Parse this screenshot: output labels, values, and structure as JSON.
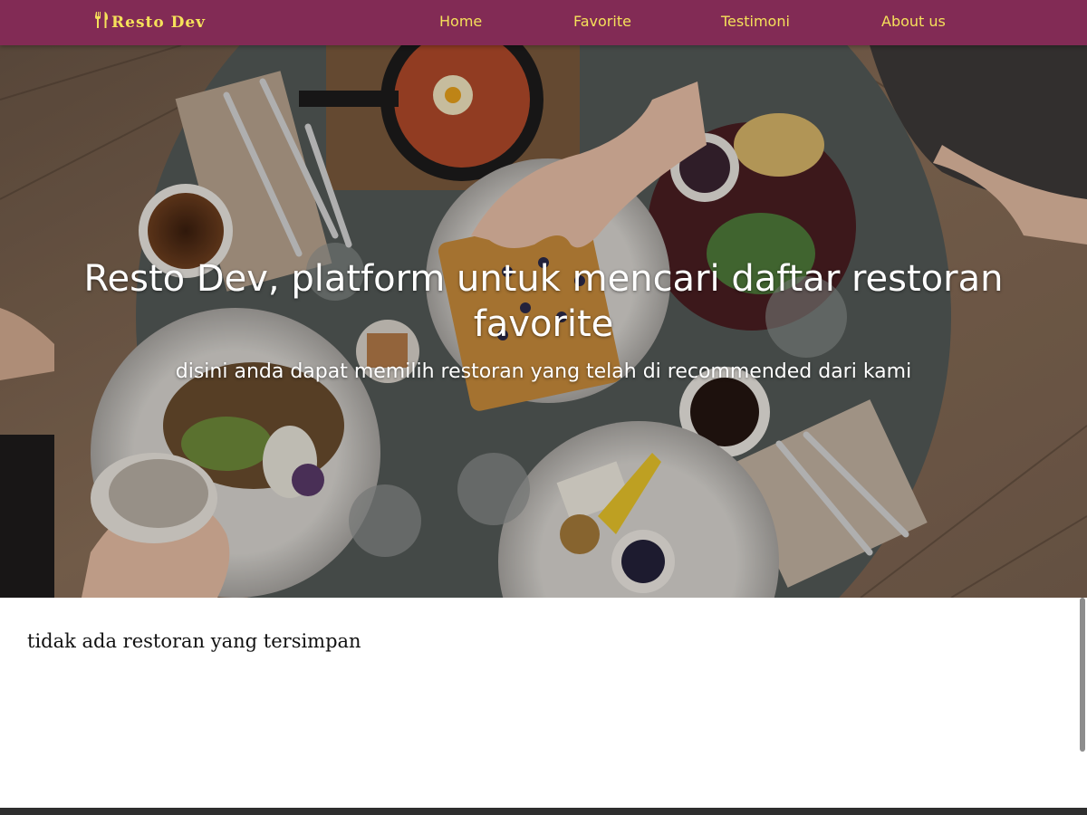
{
  "navbar": {
    "brand": "Resto Dev",
    "brand_icon": "fork-knife-icon",
    "links": [
      "Home",
      "Favorite",
      "Testimoni",
      "About us"
    ],
    "background_color": "#822b55",
    "text_color": "#f5e05a"
  },
  "hero": {
    "title": "Resto Dev, platform untuk mencari daftar restoran favorite",
    "subtitle": "disini anda dapat memilih restoran yang telah di recommended dari kami"
  },
  "content": {
    "empty_message": "tidak ada restoran yang tersimpan"
  }
}
